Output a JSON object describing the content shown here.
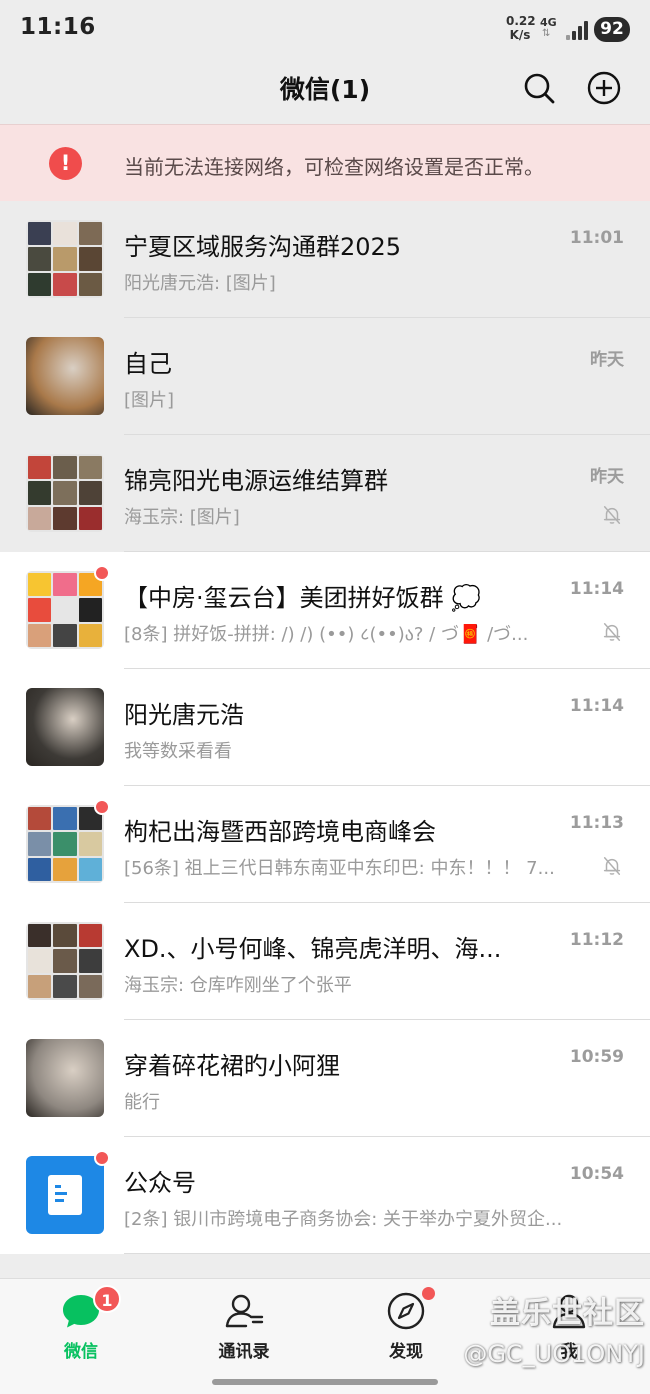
{
  "status_bar": {
    "time": "11:16",
    "net_speed_value": "0.22",
    "net_speed_unit": "K/s",
    "network_type": "4G",
    "network_arrows": "⇅",
    "battery": "92"
  },
  "header": {
    "title": "微信(1)",
    "search_icon": "search-icon",
    "add_icon": "plus-circle-icon"
  },
  "network_warning": {
    "icon": "exclamation-icon",
    "text": "当前无法连接网络，可检查网络设置是否正常。"
  },
  "chats": [
    {
      "name": "宁夏区域服务沟通群2025",
      "preview": "阳光唐元浩: [图片]",
      "time": "11:01",
      "pinned": true,
      "muted": false,
      "unread_dot": false,
      "avatar_colors": [
        "#3a3f52",
        "#e9e1da",
        "#7d6a55",
        "#4a4a3f",
        "#b99a6a",
        "#5a4634",
        "#2f3b2f",
        "#c84a4a",
        "#6b5a44"
      ]
    },
    {
      "name": "自己",
      "preview": "[图片]",
      "time": "昨天",
      "pinned": true,
      "muted": false,
      "unread_dot": false,
      "avatar_colors": [
        "#a9794a"
      ]
    },
    {
      "name": "锦亮阳光电源运维结算群",
      "preview": "海玉宗: [图片]",
      "time": "昨天",
      "pinned": true,
      "muted": true,
      "unread_dot": false,
      "avatar_colors": [
        "#c2453a",
        "#6b5e4c",
        "#8a7a62",
        "#343b2e",
        "#7d6f5b",
        "#4e4237",
        "#c8a99a",
        "#5d3a2f",
        "#9a2d2d"
      ]
    },
    {
      "name": "【中房·玺云台】美团拼好饭群 💭",
      "preview": "[8条] 拼好饭-拼拼:  /) /)  (••) ८(••)ა?  / づ🧧 /づ...",
      "time": "11:14",
      "pinned": false,
      "muted": true,
      "unread_dot": true,
      "avatar_colors": [
        "#f7c531",
        "#f06d8b",
        "#f5a623",
        "#e84c3d",
        "#e6e6e6",
        "#222222",
        "#d9a07a",
        "#444444",
        "#e8b13b"
      ]
    },
    {
      "name": "阳光唐元浩",
      "preview": "我等数采看看",
      "time": "11:14",
      "pinned": false,
      "muted": false,
      "unread_dot": false,
      "avatar_colors": [
        "#3d3a36"
      ]
    },
    {
      "name": "枸杞出海暨西部跨境电商峰会",
      "preview": "[56条] 祖上三代日韩东南亚中东印巴: 中东！！！ 7...",
      "time": "11:13",
      "pinned": false,
      "muted": true,
      "unread_dot": true,
      "avatar_colors": [
        "#b44a3a",
        "#3a6fb0",
        "#2c2c2c",
        "#7a8fa8",
        "#3b8f6a",
        "#d8c9a0",
        "#2f5fa0",
        "#e6a23c",
        "#5fb0d8"
      ]
    },
    {
      "name": "XD.、小号何峰、锦亮虎洋明、海...",
      "preview": "海玉宗: 仓库咋刚坐了个张平",
      "time": "11:12",
      "pinned": false,
      "muted": false,
      "unread_dot": false,
      "avatar_colors": [
        "#3a2f2a",
        "#5a4a3a",
        "#b83a32",
        "#e8e2da",
        "#6a5a4a",
        "#3d3d3d",
        "#c7a07a",
        "#4a4a4a",
        "#7a6a5a"
      ]
    },
    {
      "name": "穿着碎花裙旳小阿狸",
      "preview": "能行",
      "time": "10:59",
      "pinned": false,
      "muted": false,
      "unread_dot": false,
      "avatar_colors": [
        "#8e8780"
      ]
    },
    {
      "name": "公众号",
      "preview": "[2条] 银川市跨境电子商务协会: 关于举办宁夏外贸企...",
      "time": "10:54",
      "pinned": false,
      "muted": false,
      "unread_dot": true,
      "avatar_colors": [
        "#1e88e5"
      ]
    }
  ],
  "tabs": [
    {
      "label": "微信",
      "icon": "chat-bubble-icon",
      "badge": "1",
      "active": true
    },
    {
      "label": "通讯录",
      "icon": "contacts-icon",
      "badge": "",
      "active": false
    },
    {
      "label": "发现",
      "icon": "compass-icon",
      "badge": "",
      "dot": true,
      "active": false
    },
    {
      "label": "我",
      "icon": "person-icon",
      "badge": "",
      "active": false
    }
  ],
  "watermark": {
    "line1": "盖乐世社区",
    "line2": "@GC_UO1ONYJ"
  }
}
